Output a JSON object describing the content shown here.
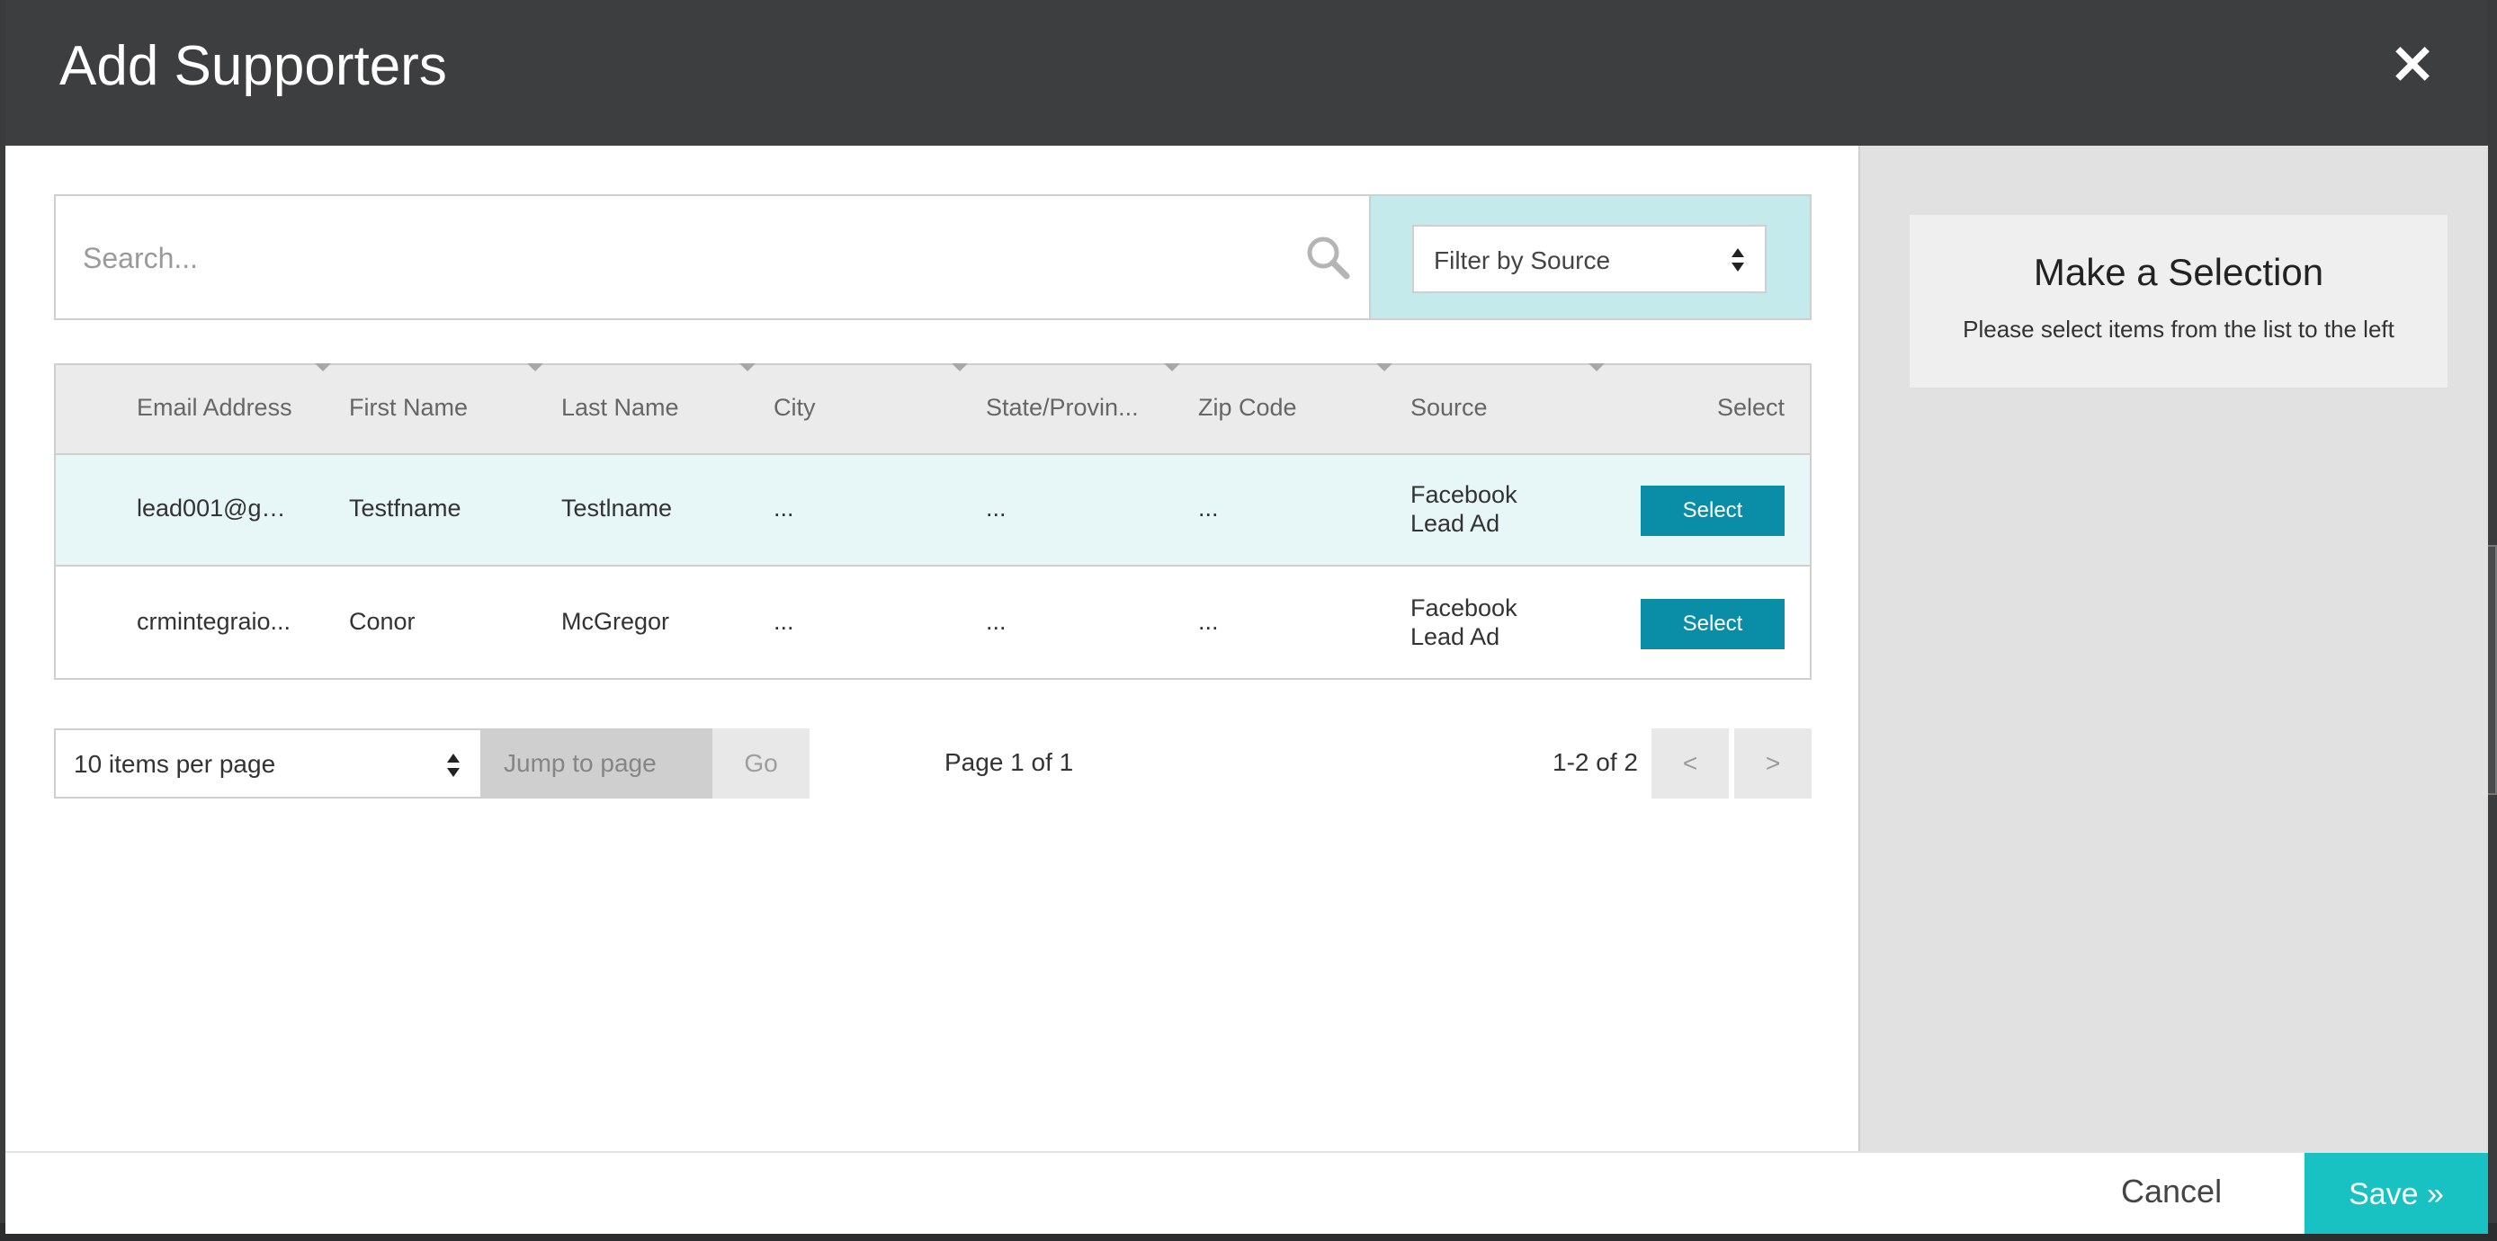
{
  "modal": {
    "title": "Add Supporters",
    "close_glyph": "×"
  },
  "search": {
    "placeholder": "Search...",
    "icon": "search-icon"
  },
  "filter": {
    "label": "Filter by Source"
  },
  "table": {
    "columns": [
      "Email Address",
      "First Name",
      "Last Name",
      "City",
      "State/Provin...",
      "Zip Code",
      "Source",
      "Select"
    ],
    "rows": [
      {
        "email": "lead001@gm...",
        "first_name": "Testfname",
        "last_name": "Testlname",
        "city": "...",
        "state": "...",
        "zip": "...",
        "source": "Facebook Lead Ad",
        "select_label": "Select"
      },
      {
        "email": "crmintegraio...",
        "first_name": "Conor",
        "last_name": "McGregor",
        "city": "...",
        "state": "...",
        "zip": "...",
        "source": "Facebook Lead Ad",
        "select_label": "Select"
      }
    ]
  },
  "pagination": {
    "per_page": "10 items per page",
    "jump_placeholder": "Jump to page",
    "go_label": "Go",
    "page_info": "Page 1 of 1",
    "range_info": "1-2 of 2",
    "prev_label": "<",
    "next_label": ">"
  },
  "selection_panel": {
    "title": "Make a Selection",
    "subtitle": "Please select items from the list to the left"
  },
  "footer": {
    "cancel_label": "Cancel",
    "save_label": "Save »"
  },
  "colors": {
    "header_bg": "#3d3e40",
    "accent_teal": "#0a8ea8",
    "save_teal": "#18c2c2",
    "filter_bg": "#c5eaec",
    "row_highlight": "#e7f6f6"
  }
}
